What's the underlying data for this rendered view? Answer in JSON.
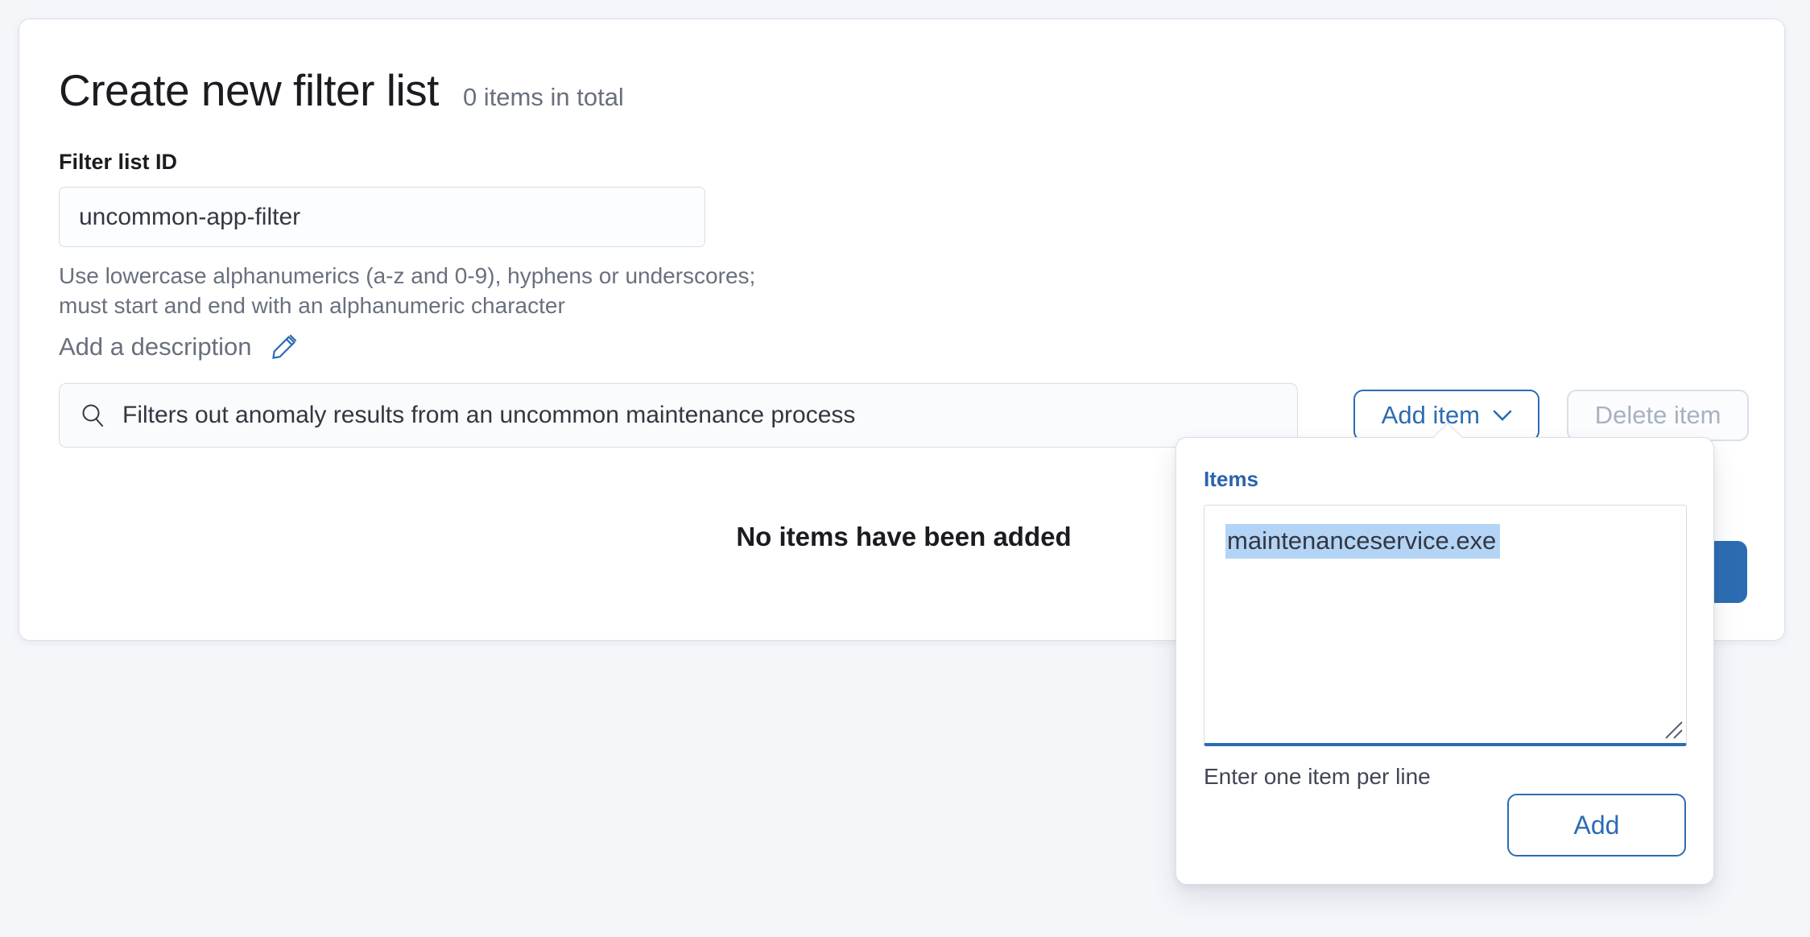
{
  "card": {
    "title": "Create new filter list",
    "items_total": "0 items in total",
    "id_field": {
      "label": "Filter list ID",
      "value": "uncommon-app-filter",
      "help_line1": "Use lowercase alphanumerics (a-z and 0-9), hyphens or underscores;",
      "help_line2": "must start and end with an alphanumeric character"
    },
    "description": {
      "link_label": "Add a description",
      "edit_icon": "pencil-icon",
      "search_icon": "magnifier-icon",
      "value": "Filters out anomaly results from an uncommon maintenance process"
    },
    "toolbar": {
      "add_item_label": "Add item",
      "add_item_icon": "chevron-down-icon",
      "delete_item_label": "Delete item"
    },
    "empty_state": "No items have been added"
  },
  "popover": {
    "items_label": "Items",
    "textarea_value": "maintenanceservice.exe",
    "help": "Enter one item per line",
    "add_label": "Add"
  },
  "colors": {
    "primary": "#2c6cb2",
    "selection_highlight": "#b3d4f5",
    "border": "#d9e0ea",
    "muted_text": "#69707d",
    "disabled_text": "#a7b1c2",
    "page_background": "#f4f6fa"
  }
}
